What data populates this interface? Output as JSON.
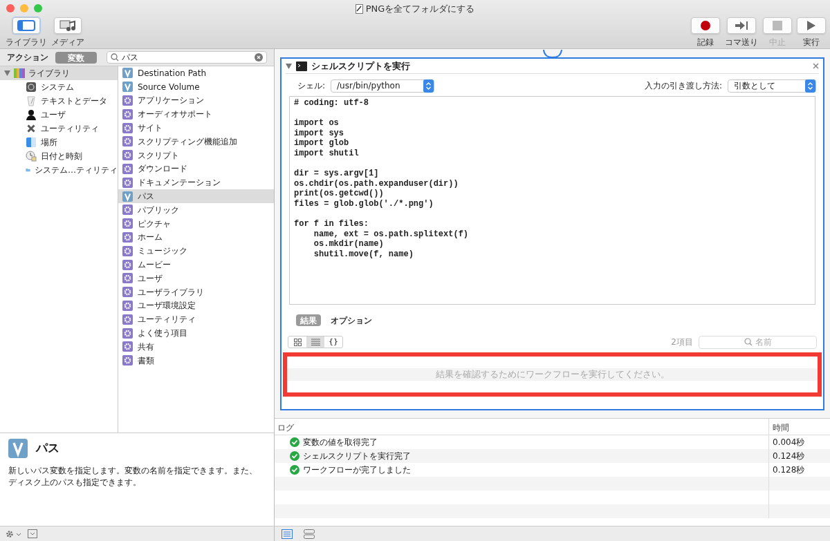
{
  "window": {
    "title": "PNGを全てフォルダにする"
  },
  "toolbar": {
    "left": [
      {
        "label": "ライブラリ",
        "kind": "library",
        "selected": true
      },
      {
        "label": "メディア",
        "kind": "media",
        "selected": false
      }
    ],
    "right": [
      {
        "label": "記録",
        "kind": "record",
        "disabled": false
      },
      {
        "label": "コマ送り",
        "kind": "step",
        "disabled": false
      },
      {
        "label": "中止",
        "kind": "stop",
        "disabled": true
      },
      {
        "label": "実行",
        "kind": "run",
        "disabled": false
      }
    ]
  },
  "sidebar": {
    "tabs": [
      {
        "label": "アクション",
        "selected": false
      },
      {
        "label": "変数",
        "selected": true
      }
    ],
    "search": {
      "value": "パス"
    },
    "library": {
      "label": "ライブラリ",
      "expanded": true,
      "children": [
        {
          "label": "システム",
          "kind": "system"
        },
        {
          "label": "テキストとデータ",
          "kind": "text"
        },
        {
          "label": "ユーザ",
          "kind": "user"
        },
        {
          "label": "ユーティリティ",
          "kind": "utility"
        },
        {
          "label": "場所",
          "kind": "places"
        },
        {
          "label": "日付と時刻",
          "kind": "datetime"
        },
        {
          "label": "システム…ティリティ",
          "kind": "folder"
        }
      ]
    },
    "actions": [
      {
        "label": "Destination Path",
        "kind": "variable",
        "selected": false
      },
      {
        "label": "Source Volume",
        "kind": "variable",
        "selected": false
      },
      {
        "label": "アプリケーション",
        "kind": "action",
        "selected": false
      },
      {
        "label": "オーディオサポート",
        "kind": "action",
        "selected": false
      },
      {
        "label": "サイト",
        "kind": "action",
        "selected": false
      },
      {
        "label": "スクリプティング機能追加",
        "kind": "action",
        "selected": false
      },
      {
        "label": "スクリプト",
        "kind": "action",
        "selected": false
      },
      {
        "label": "ダウンロード",
        "kind": "action",
        "selected": false
      },
      {
        "label": "ドキュメンテーション",
        "kind": "action",
        "selected": false
      },
      {
        "label": "パス",
        "kind": "variable",
        "selected": true
      },
      {
        "label": "パブリック",
        "kind": "action",
        "selected": false
      },
      {
        "label": "ピクチャ",
        "kind": "action",
        "selected": false
      },
      {
        "label": "ホーム",
        "kind": "action",
        "selected": false
      },
      {
        "label": "ミュージック",
        "kind": "action",
        "selected": false
      },
      {
        "label": "ムービー",
        "kind": "action",
        "selected": false
      },
      {
        "label": "ユーザ",
        "kind": "action",
        "selected": false
      },
      {
        "label": "ユーザライブラリ",
        "kind": "action",
        "selected": false
      },
      {
        "label": "ユーザ環境設定",
        "kind": "action",
        "selected": false
      },
      {
        "label": "ユーティリティ",
        "kind": "action",
        "selected": false
      },
      {
        "label": "よく使う項目",
        "kind": "action",
        "selected": false
      },
      {
        "label": "共有",
        "kind": "action",
        "selected": false
      },
      {
        "label": "書類",
        "kind": "action",
        "selected": false
      }
    ],
    "description": {
      "title": "パス",
      "text": "新しいパス変数を指定します。変数の名前を指定できます。また、ディスク上のパスも指定できます。"
    }
  },
  "action_card": {
    "title": "シェルスクリプトを実行",
    "expanded": true,
    "shell_label": "シェル:",
    "shell_value": "/usr/bin/python",
    "input_label": "入力の引き渡し方法:",
    "input_value": "引数として",
    "code": "# coding: utf-8\n\nimport os\nimport sys\nimport glob\nimport shutil\n\ndir = sys.argv[1]\nos.chdir(os.path.expanduser(dir))\nprint(os.getcwd())\nfiles = glob.glob('./*.png')\n\nfor f in files:\n    name, ext = os.path.splitext(f)\n    os.mkdir(name)\n    shutil.move(f, name)",
    "tabs": [
      {
        "label": "結果",
        "selected": true
      },
      {
        "label": "オプション",
        "selected": false
      }
    ],
    "view_buttons": [
      {
        "kind": "icons",
        "selected": false
      },
      {
        "kind": "list",
        "selected": true
      },
      {
        "kind": "braces",
        "label": "{}",
        "selected": false
      }
    ],
    "item_count": "2項目",
    "search_placeholder": "名前",
    "empty_message": "結果を確認するためにワークフローを実行してください。"
  },
  "log": {
    "columns": [
      "ログ",
      "時間"
    ],
    "rows": [
      {
        "message": "変数の値を取得完了",
        "time": "0.004秒"
      },
      {
        "message": "シェルスクリプトを実行完了",
        "time": "0.124秒"
      },
      {
        "message": "ワークフローが完了しました",
        "time": "0.128秒"
      }
    ]
  }
}
